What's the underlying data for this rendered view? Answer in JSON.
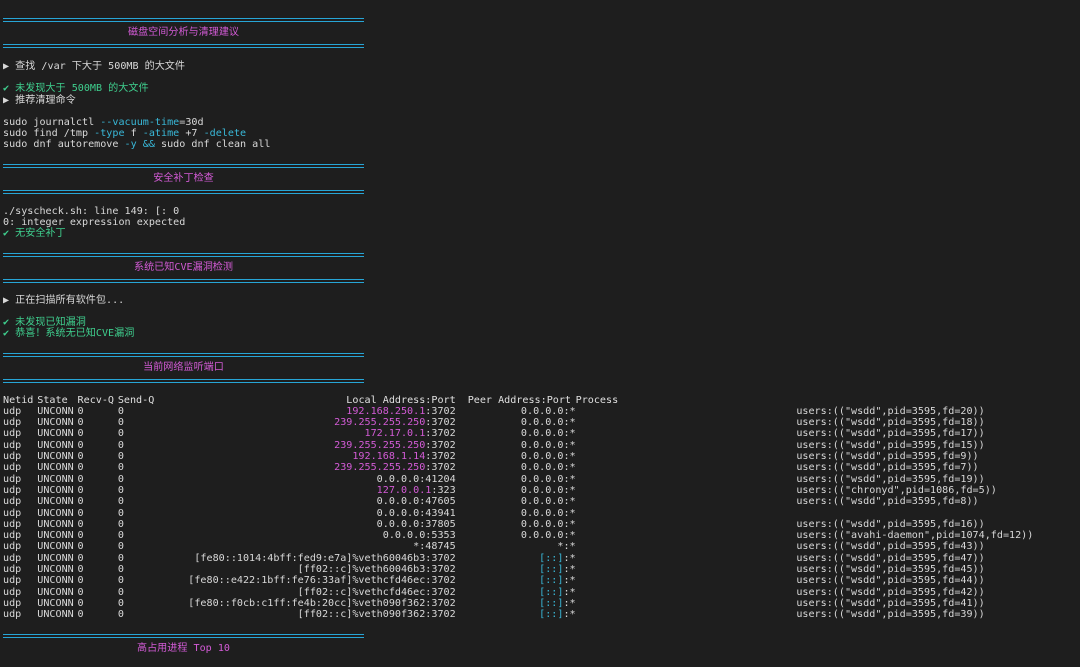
{
  "sections": {
    "disk": {
      "title": "磁盘空间分析与清理建议",
      "find_prompt": "▶ 查找 /var 下大于 500MB 的大文件",
      "no_large": "✔ 未发现大于 500MB 的大文件",
      "recommend": "▶ 推荐清理命令",
      "cmd1_a": "sudo journalctl ",
      "cmd1_b": "--vacuum-time",
      "cmd1_c": "=30d",
      "cmd2_a": "sudo find /tmp ",
      "cmd2_b": "-type",
      "cmd2_c": " f ",
      "cmd2_d": "-atime",
      "cmd2_e": " +7 ",
      "cmd2_f": "-delete",
      "cmd3_a": "sudo dnf autoremove ",
      "cmd3_b": "-y",
      "cmd3_c": " ",
      "cmd3_d": "&&",
      "cmd3_e": " sudo dnf clean all"
    },
    "patch": {
      "title": "安全补丁检查",
      "err1": "./syscheck.sh: line 149: [: 0",
      "err2": "0: integer expression expected",
      "ok": "✔ 无安全补丁"
    },
    "cve": {
      "title": "系统已知CVE漏洞检测",
      "scanning": "▶ 正在扫描所有软件包...",
      "none": "✔ 未发现已知漏洞",
      "congrats": "✔ 恭喜！系统无已知CVE漏洞"
    },
    "ports": {
      "title": "当前网络监听端口",
      "headers": {
        "netid": "Netid",
        "state": "State",
        "recv": "Recv-Q",
        "send": "Send-Q",
        "local": "Local Address:Port",
        "peer": "Peer Address:Port",
        "process": "Process"
      },
      "rows": [
        {
          "netid": "udp",
          "state": "UNCONN",
          "recv": "0",
          "send": "0",
          "local_ip": "192.168.250.1",
          "local_port": ":3702",
          "peer_ip": "0.0.0.0",
          "peer_port": ":*",
          "process": "users:((\"wsdd\",pid=3595,fd=20))"
        },
        {
          "netid": "udp",
          "state": "UNCONN",
          "recv": "0",
          "send": "0",
          "local_ip": "239.255.255.250",
          "local_port": ":3702",
          "peer_ip": "0.0.0.0",
          "peer_port": ":*",
          "process": "users:((\"wsdd\",pid=3595,fd=18))"
        },
        {
          "netid": "udp",
          "state": "UNCONN",
          "recv": "0",
          "send": "0",
          "local_ip": "172.17.0.1",
          "local_port": ":3702",
          "peer_ip": "0.0.0.0",
          "peer_port": ":*",
          "process": "users:((\"wsdd\",pid=3595,fd=17))"
        },
        {
          "netid": "udp",
          "state": "UNCONN",
          "recv": "0",
          "send": "0",
          "local_ip": "239.255.255.250",
          "local_port": ":3702",
          "peer_ip": "0.0.0.0",
          "peer_port": ":*",
          "process": "users:((\"wsdd\",pid=3595,fd=15))"
        },
        {
          "netid": "udp",
          "state": "UNCONN",
          "recv": "0",
          "send": "0",
          "local_ip": "192.168.1.14",
          "local_port": ":3702",
          "peer_ip": "0.0.0.0",
          "peer_port": ":*",
          "process": "users:((\"wsdd\",pid=3595,fd=9))"
        },
        {
          "netid": "udp",
          "state": "UNCONN",
          "recv": "0",
          "send": "0",
          "local_ip": "239.255.255.250",
          "local_port": ":3702",
          "peer_ip": "0.0.0.0",
          "peer_port": ":*",
          "process": "users:((\"wsdd\",pid=3595,fd=7))"
        },
        {
          "netid": "udp",
          "state": "UNCONN",
          "recv": "0",
          "send": "0",
          "local_ip": "0.0.0.0",
          "local_port": ":41204",
          "peer_ip": "0.0.0.0",
          "peer_port": ":*",
          "process": "users:((\"wsdd\",pid=3595,fd=19))"
        },
        {
          "netid": "udp",
          "state": "UNCONN",
          "recv": "0",
          "send": "0",
          "local_ip": "127.0.0.1",
          "local_port": ":323",
          "peer_ip": "0.0.0.0",
          "peer_port": ":*",
          "process": "users:((\"chronyd\",pid=1086,fd=5))"
        },
        {
          "netid": "udp",
          "state": "UNCONN",
          "recv": "0",
          "send": "0",
          "local_ip": "0.0.0.0",
          "local_port": ":47605",
          "peer_ip": "0.0.0.0",
          "peer_port": ":*",
          "process": "users:((\"wsdd\",pid=3595,fd=8))"
        },
        {
          "netid": "udp",
          "state": "UNCONN",
          "recv": "0",
          "send": "0",
          "local_ip": "0.0.0.0",
          "local_port": ":43941",
          "peer_ip": "0.0.0.0",
          "peer_port": ":*",
          "process": ""
        },
        {
          "netid": "udp",
          "state": "UNCONN",
          "recv": "0",
          "send": "0",
          "local_ip": "0.0.0.0",
          "local_port": ":37805",
          "peer_ip": "0.0.0.0",
          "peer_port": ":*",
          "process": "users:((\"wsdd\",pid=3595,fd=16))"
        },
        {
          "netid": "udp",
          "state": "UNCONN",
          "recv": "0",
          "send": "0",
          "local_ip": "0.0.0.0",
          "local_port": ":5353",
          "peer_ip": "0.0.0.0",
          "peer_port": ":*",
          "process": "users:((\"avahi-daemon\",pid=1074,fd=12))"
        },
        {
          "netid": "udp",
          "state": "UNCONN",
          "recv": "0",
          "send": "0",
          "local_ip": "*",
          "local_port": ":48745",
          "peer_ip": "*",
          "peer_port": ":*",
          "process": "users:((\"wsdd\",pid=3595,fd=43))"
        },
        {
          "netid": "udp",
          "state": "UNCONN",
          "recv": "0",
          "send": "0",
          "local_ip": "[fe80::1014:4bff:fed9:e7a]%veth60046b3",
          "local_port": ":3702",
          "peer_ip": "[::]",
          "peer_port": ":*",
          "process": "users:((\"wsdd\",pid=3595,fd=47))"
        },
        {
          "netid": "udp",
          "state": "UNCONN",
          "recv": "0",
          "send": "0",
          "local_ip": "[ff02::c]%veth60046b3",
          "local_port": ":3702",
          "peer_ip": "[::]",
          "peer_port": ":*",
          "process": "users:((\"wsdd\",pid=3595,fd=45))"
        },
        {
          "netid": "udp",
          "state": "UNCONN",
          "recv": "0",
          "send": "0",
          "local_ip": "[fe80::e422:1bff:fe76:33af]%vethcfd46ec",
          "local_port": ":3702",
          "peer_ip": "[::]",
          "peer_port": ":*",
          "process": "users:((\"wsdd\",pid=3595,fd=44))"
        },
        {
          "netid": "udp",
          "state": "UNCONN",
          "recv": "0",
          "send": "0",
          "local_ip": "[ff02::c]%vethcfd46ec",
          "local_port": ":3702",
          "peer_ip": "[::]",
          "peer_port": ":*",
          "process": "users:((\"wsdd\",pid=3595,fd=42))"
        },
        {
          "netid": "udp",
          "state": "UNCONN",
          "recv": "0",
          "send": "0",
          "local_ip": "[fe80::f0cb:c1ff:fe4b:20cc]%veth090f362",
          "local_port": ":3702",
          "peer_ip": "[::]",
          "peer_port": ":*",
          "process": "users:((\"wsdd\",pid=3595,fd=41))"
        },
        {
          "netid": "udp",
          "state": "UNCONN",
          "recv": "0",
          "send": "0",
          "local_ip": "[ff02::c]%veth090f362",
          "local_port": ":3702",
          "peer_ip": "[::]",
          "peer_port": ":*",
          "process": "users:((\"wsdd\",pid=3595,fd=39))"
        }
      ]
    },
    "top": {
      "title": "高占用进程 Top 10"
    }
  },
  "colors": {
    "background": "#1e1e1e",
    "rule": "#27a5d6",
    "title": "#d35bd6",
    "ok": "#3fcf8e",
    "option": "#39b8d8",
    "ip_v4": "#d35bd6",
    "ip_v6_any": "#39b8d8",
    "text": "#d8d8d8"
  }
}
